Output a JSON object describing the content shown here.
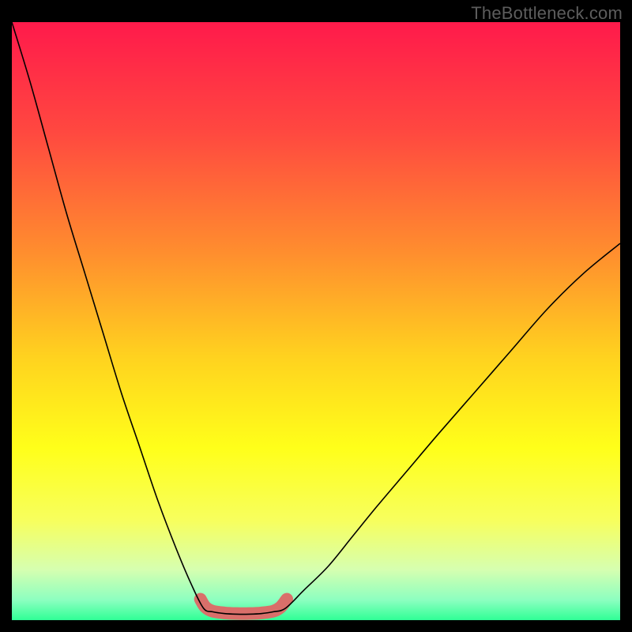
{
  "watermark": "TheBottleneck.com",
  "chart_data": {
    "type": "line",
    "title": "",
    "xlabel": "",
    "ylabel": "",
    "xlim": [
      0,
      100
    ],
    "ylim": [
      0,
      100
    ],
    "background_gradient": {
      "direction": "vertical",
      "stops": [
        {
          "pos": 0.0,
          "color": "#ff1a4b"
        },
        {
          "pos": 0.18,
          "color": "#ff4840"
        },
        {
          "pos": 0.38,
          "color": "#ff8e2e"
        },
        {
          "pos": 0.55,
          "color": "#ffd21f"
        },
        {
          "pos": 0.7,
          "color": "#ffff1a"
        },
        {
          "pos": 0.82,
          "color": "#f7ff5e"
        },
        {
          "pos": 0.9,
          "color": "#d6ffb0"
        },
        {
          "pos": 0.95,
          "color": "#8cffc0"
        },
        {
          "pos": 1.0,
          "color": "#00ff80"
        }
      ]
    },
    "series": [
      {
        "name": "left-curve",
        "x": [
          0,
          3,
          6,
          9,
          12,
          15,
          18,
          21,
          24,
          27,
          29.5,
          31.5
        ],
        "y": [
          100,
          90,
          79,
          68,
          58,
          48,
          38,
          29,
          20,
          12,
          6,
          2
        ]
      },
      {
        "name": "bottom-flat-pink",
        "x": [
          31.5,
          33,
          35,
          37,
          39,
          41,
          43,
          45
        ],
        "y": [
          2,
          1.4,
          1.1,
          1.0,
          1.0,
          1.1,
          1.4,
          2
        ]
      },
      {
        "name": "right-curve",
        "x": [
          45,
          48,
          52,
          56,
          60,
          65,
          70,
          76,
          82,
          88,
          94,
          100
        ],
        "y": [
          2,
          5,
          9,
          14,
          19,
          25,
          31,
          38,
          45,
          52,
          58,
          63
        ]
      }
    ],
    "overlay": {
      "name": "salmon-flat-segment",
      "color": "#d96f6a",
      "thickness_px": 16,
      "x": [
        31.0,
        31.8,
        33.0,
        35.0,
        37.0,
        39.0,
        41.0,
        43.0,
        44.2,
        45.2
      ],
      "y": [
        3.5,
        2.2,
        1.5,
        1.2,
        1.1,
        1.1,
        1.2,
        1.5,
        2.2,
        3.5
      ]
    }
  }
}
